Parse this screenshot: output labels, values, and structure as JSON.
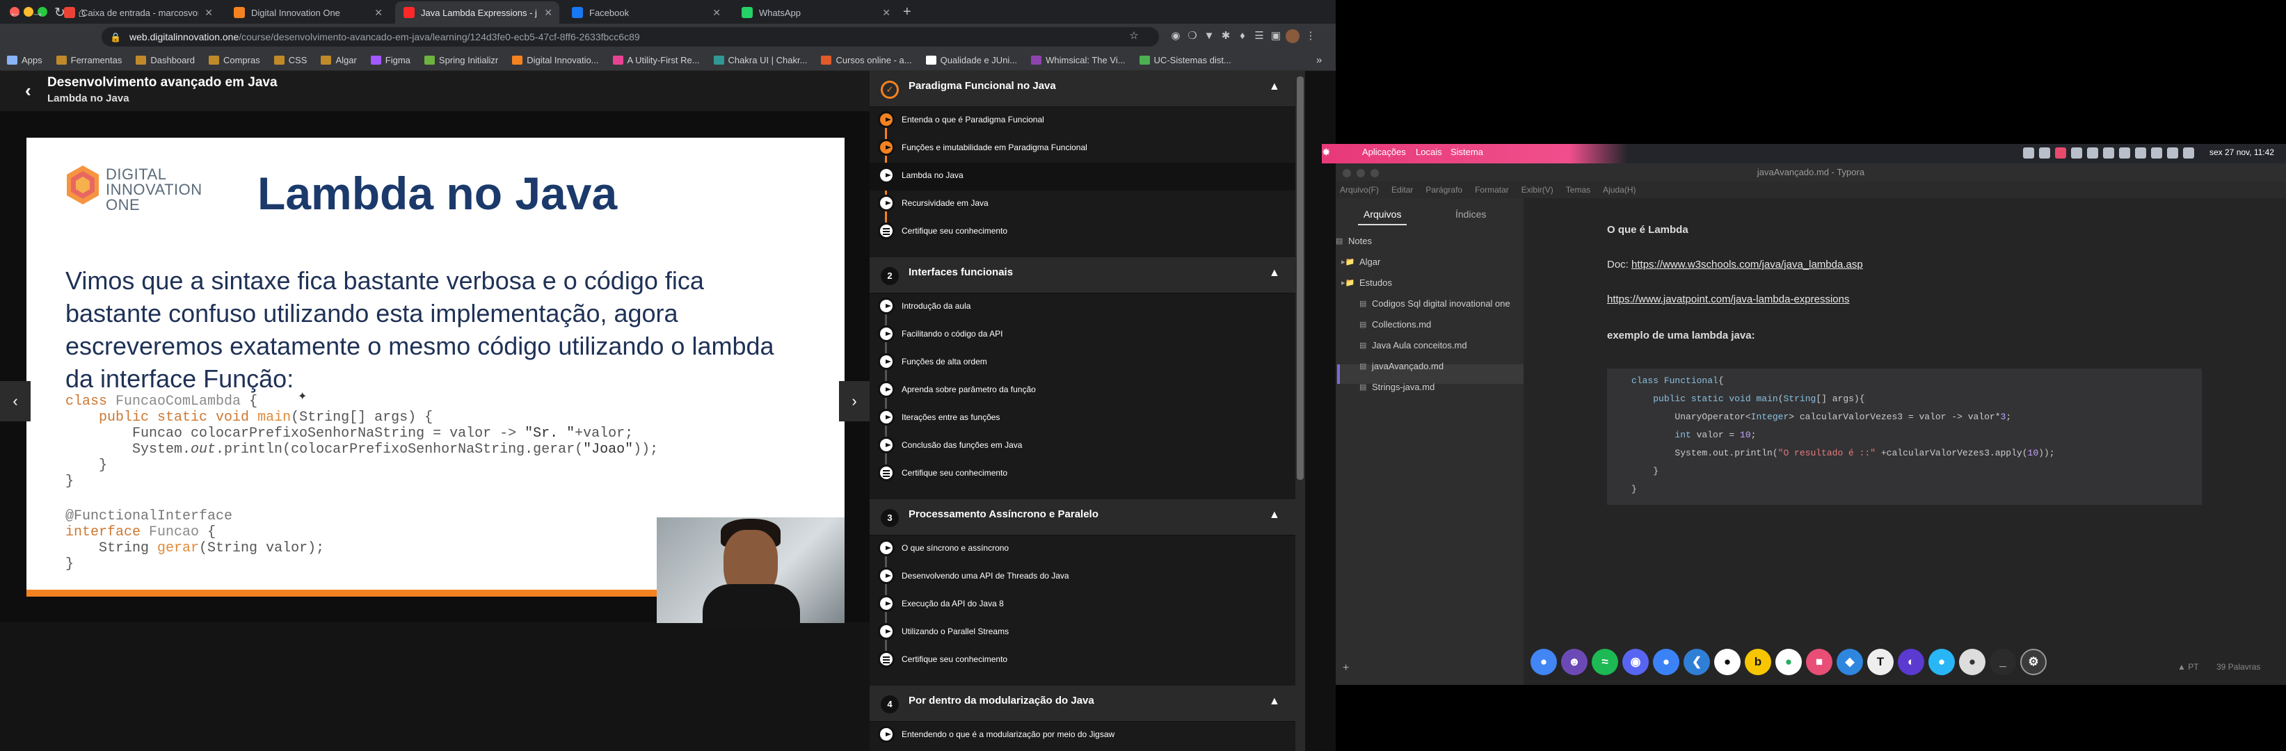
{
  "browser": {
    "tabs": [
      {
        "title": "Caixa de entrada - marcosvor",
        "favicon": "gmail-icon",
        "color": "#ea4335",
        "active": false
      },
      {
        "title": "Digital Innovation One",
        "favicon": "dio-icon",
        "color": "#f58220",
        "active": false
      },
      {
        "title": "Java Lambda Expressions - j...",
        "favicon": "w3schools-icon",
        "color": "#ff2828",
        "active": true
      },
      {
        "title": "Facebook",
        "favicon": "facebook-icon",
        "color": "#1877f2",
        "active": false
      },
      {
        "title": "WhatsApp",
        "favicon": "whatsapp-icon",
        "color": "#25d366",
        "active": false
      }
    ],
    "new_tab": "+",
    "url_host": "web.digitalinnovation.one",
    "url_path": "/course/desenvolvimento-avancado-em-java/learning/124d3fe0-ecb5-47cf-8ff6-2633fbcc6c89",
    "bookmarks": [
      {
        "label": "Apps",
        "color": "#8ab4f8"
      },
      {
        "label": "Ferramentas",
        "color": "#c08a2a"
      },
      {
        "label": "Dashboard",
        "color": "#c08a2a"
      },
      {
        "label": "Compras",
        "color": "#c08a2a"
      },
      {
        "label": "CSS",
        "color": "#c08a2a"
      },
      {
        "label": "Algar",
        "color": "#c08a2a"
      },
      {
        "label": "Figma",
        "color": "#a259ff"
      },
      {
        "label": "Spring Initializr",
        "color": "#6db33f"
      },
      {
        "label": "Digital Innovatio...",
        "color": "#f58220"
      },
      {
        "label": "A Utility-First Re...",
        "color": "#e84393"
      },
      {
        "label": "Chakra UI | Chakr...",
        "color": "#319795"
      },
      {
        "label": "Cursos online - a...",
        "color": "#e05a2a"
      },
      {
        "label": "Qualidade e JUni...",
        "color": "#ffffff"
      },
      {
        "label": "Whimsical: The Vi...",
        "color": "#8e44ad"
      },
      {
        "label": "UC-Sistemas dist...",
        "color": "#4caf50"
      }
    ],
    "more": "»"
  },
  "course": {
    "title": "Desenvolvimento avançado em Java",
    "subtitle": "Lambda no Java"
  },
  "slide": {
    "logo_line1": "DIGITAL",
    "logo_line2": "INNOVATION",
    "logo_line3": "ONE",
    "title": "Lambda no Java",
    "paragraph": "Vimos que a sintaxe fica bastante verbosa e o código fica bastante confuso utilizando esta implementação, agora escreveremos exatamente o mesmo código utilizando o lambda da interface Função:"
  },
  "sidebar": {
    "sections": [
      {
        "num": "",
        "title": "Paradigma Funcional no Java",
        "lessons": [
          "Entenda o que é Paradigma Funcional",
          "Funções e imutabilidade em Paradigma Funcional",
          "Lambda no Java",
          "Recursividade em Java",
          "Certifique seu conhecimento"
        ]
      },
      {
        "num": "2",
        "title": "Interfaces funcionais",
        "lessons": [
          "Introdução da aula",
          "Facilitando o código da API",
          "Funções de alta ordem",
          "Aprenda sobre parâmetro da função",
          "Iterações entre as funções",
          "Conclusão das funções em Java",
          "Certifique seu conhecimento"
        ]
      },
      {
        "num": "3",
        "title": "Processamento Assíncrono e Paralelo",
        "lessons": [
          "O que síncrono e assíncrono",
          "Desenvolvendo uma API de Threads do Java",
          "Execução da API do Java 8",
          "Utilizando o Parallel Streams",
          "Certifique seu conhecimento"
        ]
      },
      {
        "num": "4",
        "title": "Por dentro da modularização do Java",
        "lessons": [
          "Entendendo o que é a modularização por meio do Jigsaw"
        ]
      }
    ]
  },
  "desktop": {
    "menu": [
      "Aplicações",
      "Locais",
      "Sistema"
    ],
    "clock": "sex 27 nov, 11:42"
  },
  "typora": {
    "window_title": "javaAvançado.md - Typora",
    "menu": [
      "Arquivo(F)",
      "Editar",
      "Parágrafo",
      "Formatar",
      "Exibir(V)",
      "Temas",
      "Ajuda(H)"
    ],
    "tab_files": "Arquivos",
    "tab_index": "Índices",
    "tree": [
      "Notes",
      "Algar",
      "Estudos",
      "Codigos Sql digital inovational one",
      "Collections.md",
      "Java Aula conceitos.md",
      "javaAvançado.md",
      "Strings-java.md"
    ],
    "doc": {
      "heading": "O que é Lambda",
      "doc_label": "Doc: ",
      "link1": "https://www.w3schools.com/java/java_lambda.asp",
      "link2": "https://www.javatpoint.com/java-lambda-expressions",
      "example_heading": "exemplo de uma lambda java:"
    },
    "status": "39 Palavras",
    "lang": "PT"
  }
}
